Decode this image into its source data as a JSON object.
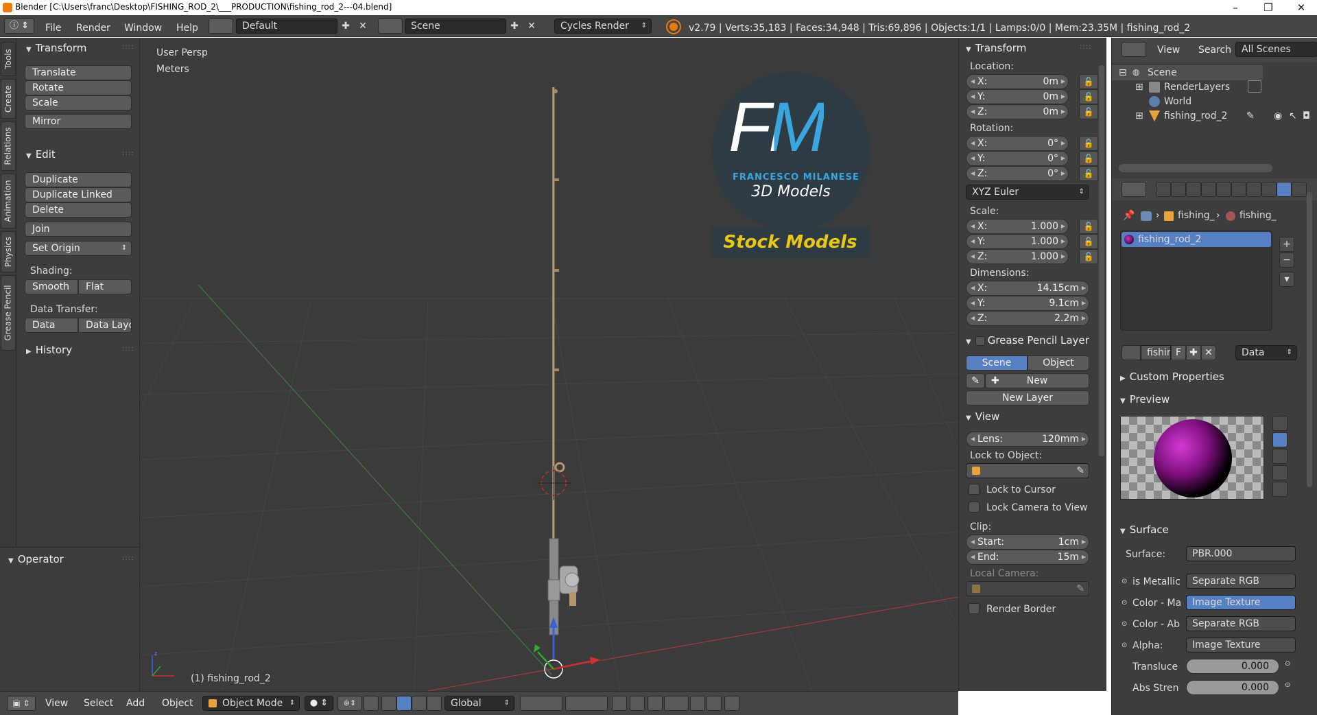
{
  "window": {
    "title": "Blender [C:\\Users\\franc\\Desktop\\FISHING_ROD_2\\___PRODUCTION\\fishing_rod_2---04.blend]",
    "minimize": "–",
    "maximize": "❐",
    "close": "✕"
  },
  "infobar": {
    "menus": [
      "File",
      "Render",
      "Window",
      "Help"
    ],
    "layout": "Default",
    "scene": "Scene",
    "engine": "Cycles Render",
    "stats": "v2.79 | Verts:35,183 | Faces:34,948 | Tris:69,896 | Objects:1/1 | Lamps:0/0 | Mem:23.35M | fishing_rod_2"
  },
  "tool_tabs": [
    "Tools",
    "Create",
    "Relations",
    "Animation",
    "Physics",
    "Grease Pencil"
  ],
  "toolshelf": {
    "transform": {
      "title": "Transform",
      "buttons": [
        "Translate",
        "Rotate",
        "Scale",
        "Mirror"
      ]
    },
    "edit": {
      "title": "Edit",
      "buttons": [
        "Duplicate",
        "Duplicate Linked",
        "Delete",
        "Join"
      ],
      "set_origin": "Set Origin",
      "shading_label": "Shading:",
      "smooth": "Smooth",
      "flat": "Flat",
      "data_transfer_label": "Data Transfer:",
      "data": "Data",
      "data_layout": "Data Layo"
    },
    "history": "History"
  },
  "operator": {
    "title": "Operator"
  },
  "viewport": {
    "view_name": "User Persp",
    "units": "Meters",
    "object_label": "(1) fishing_rod_2",
    "logo": {
      "big": "FM",
      "name": "FRANCESCO MILANESE",
      "sub": "3D Models",
      "banner": "Stock Models"
    }
  },
  "header3d": {
    "menus": [
      "View",
      "Select",
      "Add",
      "Object"
    ],
    "mode": "Object Mode",
    "orientation": "Global"
  },
  "npanel": {
    "transform_title": "Transform",
    "location_label": "Location:",
    "location": [
      {
        "axis": "X:",
        "value": "0m"
      },
      {
        "axis": "Y:",
        "value": "0m"
      },
      {
        "axis": "Z:",
        "value": "0m"
      }
    ],
    "rotation_label": "Rotation:",
    "rotation": [
      {
        "axis": "X:",
        "value": "0°"
      },
      {
        "axis": "Y:",
        "value": "0°"
      },
      {
        "axis": "Z:",
        "value": "0°"
      }
    ],
    "rotation_mode": "XYZ Euler",
    "scale_label": "Scale:",
    "scale": [
      {
        "axis": "X:",
        "value": "1.000"
      },
      {
        "axis": "Y:",
        "value": "1.000"
      },
      {
        "axis": "Z:",
        "value": "1.000"
      }
    ],
    "dimensions_label": "Dimensions:",
    "dimensions": [
      {
        "axis": "X:",
        "value": "14.15cm"
      },
      {
        "axis": "Y:",
        "value": "9.1cm"
      },
      {
        "axis": "Z:",
        "value": "2.2m"
      }
    ],
    "grease_title": "Grease Pencil Layer",
    "scene_tab": "Scene",
    "object_tab": "Object",
    "new": "New",
    "new_layer": "New Layer",
    "view_title": "View",
    "lens_label": "Lens:",
    "lens_value": "120mm",
    "lock_object_label": "Lock to Object:",
    "lock_cursor": "Lock to Cursor",
    "lock_camera": "Lock Camera to View",
    "clip_label": "Clip:",
    "clip_start_label": "Start:",
    "clip_start": "1cm",
    "clip_end_label": "End:",
    "clip_end": "15m",
    "local_camera": "Local Camera:",
    "render_border": "Render Border"
  },
  "outliner": {
    "view": "View",
    "search": "Search",
    "filter": "All Scenes",
    "items": [
      "Scene",
      "RenderLayers",
      "World",
      "fishing_rod_2"
    ]
  },
  "properties": {
    "breadcrumb1": "fishing_",
    "breadcrumb2": "fishing_",
    "material_slot": "fishing_rod_2",
    "mat_name": "fishin",
    "f_btn": "F",
    "data_sel": "Data",
    "custom_props": "Custom Properties",
    "preview": "Preview",
    "surface_title": "Surface",
    "surface_label": "Surface:",
    "surface_value": "PBR.000",
    "inputs": [
      {
        "label": "is Metallic",
        "value": "Separate RGB"
      },
      {
        "label": "Color - Ma",
        "value": "Image Texture"
      },
      {
        "label": "Color - Ab",
        "value": "Separate RGB"
      },
      {
        "label": "Alpha:",
        "value": "Image Texture"
      }
    ],
    "translucency_label": "Transluce",
    "translucency": "0.000",
    "abs_label": "Abs Stren",
    "abs": "0.000"
  },
  "colors": {
    "accent": "#5680c2",
    "logo_blue": "#3aa6e0",
    "banner_text": "#e8c812",
    "rod": "#a88a66"
  }
}
